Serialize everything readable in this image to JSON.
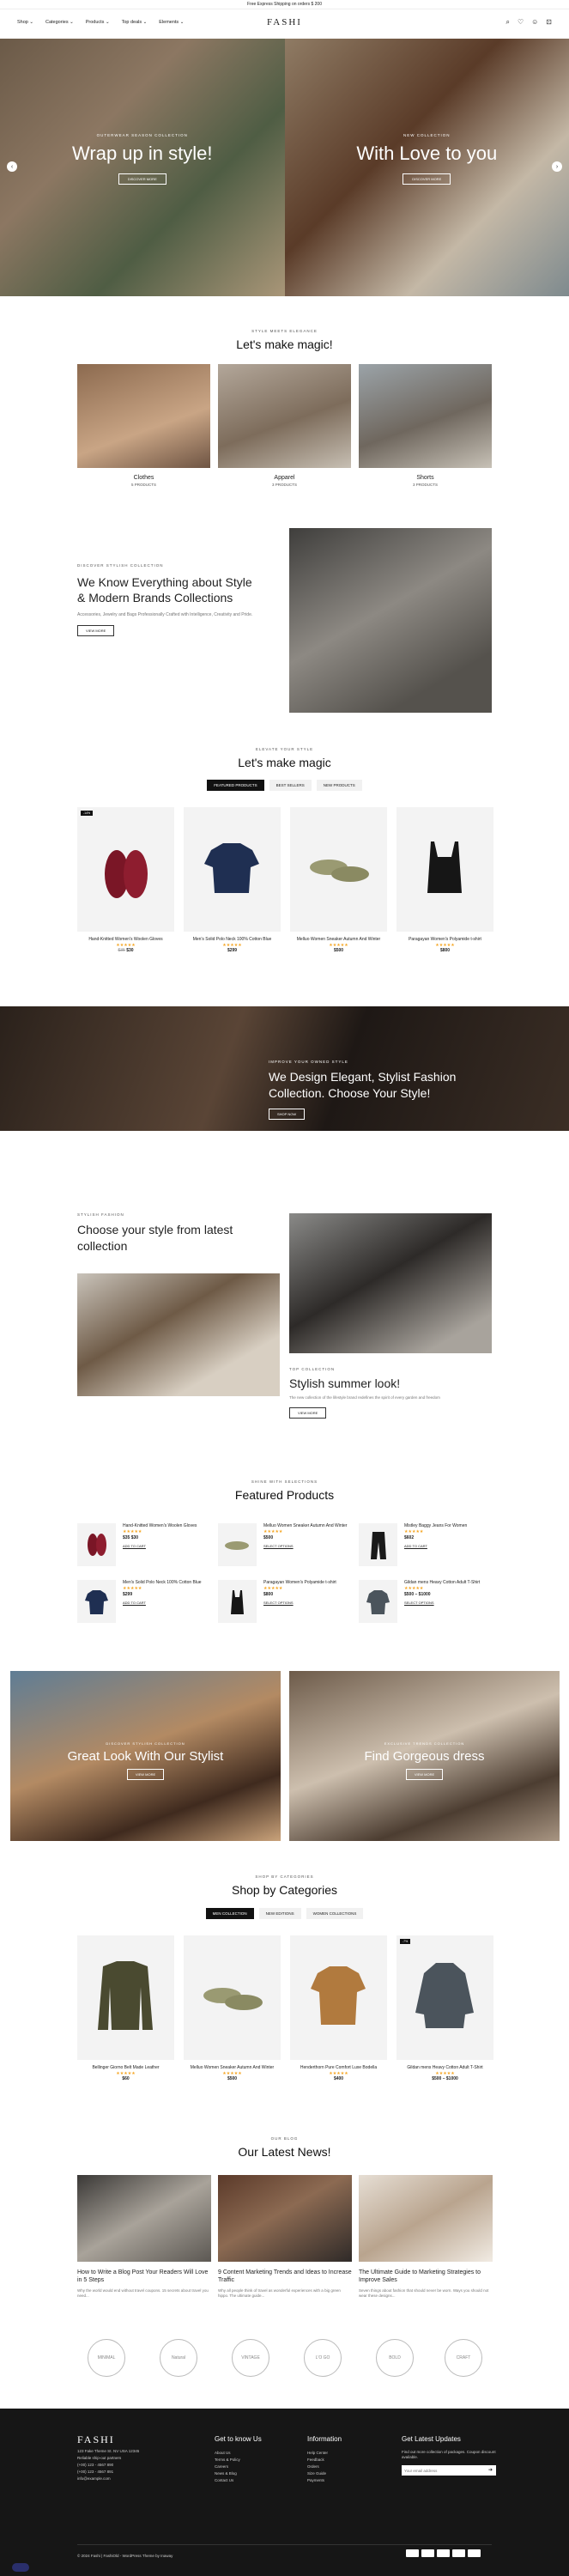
{
  "topbar": {
    "text": "Free Express Shipping on orders $ 200"
  },
  "header": {
    "nav": [
      "Shop ⌄",
      "Categories ⌄",
      "Products ⌄",
      "Top deals ⌄",
      "Elements ⌄"
    ],
    "logo": "FASHI"
  },
  "hero": {
    "left": {
      "eyebrow": "OUTERWEAR SEASON COLLECTION",
      "title": "Wrap up in style!",
      "button": "DISCOVER MORE"
    },
    "right": {
      "eyebrow": "NEW COLLECTION",
      "title": "With Love to you",
      "button": "DISCOVER MORE"
    }
  },
  "categories_section": {
    "eyebrow": "STYLE MEETS ELEGANCE",
    "title": "Let's make magic!",
    "items": [
      {
        "name": "Clothes",
        "count": "5 PRODUCTS"
      },
      {
        "name": "Apparel",
        "count": "3 PRODUCTS"
      },
      {
        "name": "Shorts",
        "count": "3 PRODUCTS"
      }
    ]
  },
  "about": {
    "eyebrow": "DISCOVER STYLISH COLLECTION",
    "title": "We Know Everything about Style & Modern Brands Collections",
    "text": "Accessories, Jewelry and Bags Professionally Crafted with Intelligence, Creativity and Pride.",
    "button": "VIEW MORE"
  },
  "products_section": {
    "eyebrow": "ELEVATE YOUR STYLE",
    "title": "Let's make magic",
    "tabs": [
      "FEATURED PRODUCTS",
      "BEST SELLERS",
      "NEW PRODUCTS"
    ],
    "items": [
      {
        "name": "Hand-Knitted Women's Woolen Gloves",
        "stars": "★★★★★",
        "old_price": "$35",
        "price": "$30",
        "badge": "-14%"
      },
      {
        "name": "Men's Solid Polo Neck 100% Cotton Blue",
        "stars": "★★★★★",
        "price": "$299"
      },
      {
        "name": "Melluo Women Sneaker Autumn And Winter",
        "stars": "★★★★★",
        "price": "$500"
      },
      {
        "name": "Paragayan Women's Polyamide t-shirt",
        "stars": "★★★★★",
        "price": "$800"
      }
    ]
  },
  "band": {
    "eyebrow": "IMPROVE YOUR OWNED STYLE",
    "title": "We Design Elegant, Stylist Fashion Collection. Choose Your Style!",
    "button": "SHOP NOW"
  },
  "latest": {
    "eyebrow": "STYLISH FASHION",
    "title": "Choose your style from latest collection",
    "top_label": "TOP COLLECTION",
    "subtitle": "Stylish summer look!",
    "text": "The new collection of the lifestyle brand redefines the spirit of every garden and freedom",
    "button": "VIEW MORE"
  },
  "featured": {
    "eyebrow": "SHINE WITH SELECTIONS",
    "title": "Featured Products",
    "items": [
      {
        "name": "Hand-Knitted Women's Woolen Gloves",
        "stars": "★★★★★",
        "price": "$35 $30",
        "cart": "ADD TO CART"
      },
      {
        "name": "Melluo Women Sneaker Autumn And Winter",
        "stars": "★★★★★",
        "price": "$500",
        "cart": "SELECT OPTIONS"
      },
      {
        "name": "Mistley Baggy Jeans For Women",
        "stars": "★★★★★",
        "price": "$602",
        "cart": "ADD TO CART"
      },
      {
        "name": "Men's Solid Polo Neck 100% Cotton Blue",
        "stars": "★★★★★",
        "price": "$299",
        "cart": "ADD TO CART"
      },
      {
        "name": "Paragayan Women's Polyamide t-shirt",
        "stars": "★★★★★",
        "price": "$800",
        "cart": "SELECT OPTIONS"
      },
      {
        "name": "Gildan mens Heavy Cotton Adult T-Shirt",
        "stars": "★★★★★",
        "price": "$500 – $1000",
        "cart": "SELECT OPTIONS"
      }
    ]
  },
  "promos": [
    {
      "eyebrow": "DISCOVER STYLISH COLLECTION",
      "title": "Great Look With Our Stylist",
      "button": "VIEW MORE"
    },
    {
      "eyebrow": "EXCLUSIVE TRENDS COLLECTION",
      "title": "Find Gorgeous dress",
      "button": "VIEW MORE"
    }
  ],
  "shop_categories": {
    "eyebrow": "SHOP BY CATEGORIES",
    "title": "Shop by Categories",
    "tabs": [
      "MEN COLLECTION",
      "NEW EDITIONS",
      "WOMEN COLLECTIONS"
    ],
    "items": [
      {
        "name": "Bellinger Giorno Belt Made Leather",
        "stars": "★★★★★",
        "price": "$60"
      },
      {
        "name": "Melluo Women Sneaker Autumn And Winter",
        "stars": "★★★★★",
        "price": "$500"
      },
      {
        "name": "Henderthorn Pure Comfort Luxe Bodella",
        "stars": "★★★★★",
        "price": "$400"
      },
      {
        "name": "Gildan mens Heavy Cotton Adult T-Shirt",
        "stars": "★★★★★",
        "price": "$500 – $1000",
        "badge": "-7%"
      }
    ]
  },
  "news": {
    "eyebrow": "OUR BLOG",
    "title": "Our Latest News!",
    "items": [
      {
        "title": "How to Write a Blog Post Your Readers Will Love in 5 Steps",
        "excerpt": "Why the world would end without travel coupons. 15 secrets about travel you need..."
      },
      {
        "title": "9 Content Marketing Trends and Ideas to Increase Traffic",
        "excerpt": "Why all people think of travel as wonderful experiences with a big green hippo. The ultimate guide..."
      },
      {
        "title": "The Ultimate Guide to Marketing Strategies to Improve Sales",
        "excerpt": "Seven things about fashion that should never be worn. Ways you should not wear these designs..."
      }
    ]
  },
  "brands": [
    "MINIMAL",
    "Natural",
    "VINTAGE",
    "L'O GO",
    "BOLD",
    "CRAFT"
  ],
  "footer": {
    "logo": "FASHI",
    "address": [
      "123 Fake Theme St. NV USA 12345",
      "Reliable ship-out partners",
      "(+00) 123 - 4567 890",
      "(+00) 123 - 4567 891",
      "info@example.com"
    ],
    "col1_title": "Get to know Us",
    "col1": [
      "About Us",
      "Terms & Policy",
      "Careers",
      "News & Blog",
      "Contact Us"
    ],
    "col2_title": "Information",
    "col2": [
      "Help Center",
      "Feedback",
      "Orders",
      "Size Guide",
      "Payments"
    ],
    "col3_title": "Get Latest Updates",
    "col3_text": "Find out more collection of packages. Coupon discount available.",
    "email_placeholder": "Your email address",
    "copyright": "© 2024 Fashi | FashiOld - WordPress Theme by Inaway"
  }
}
